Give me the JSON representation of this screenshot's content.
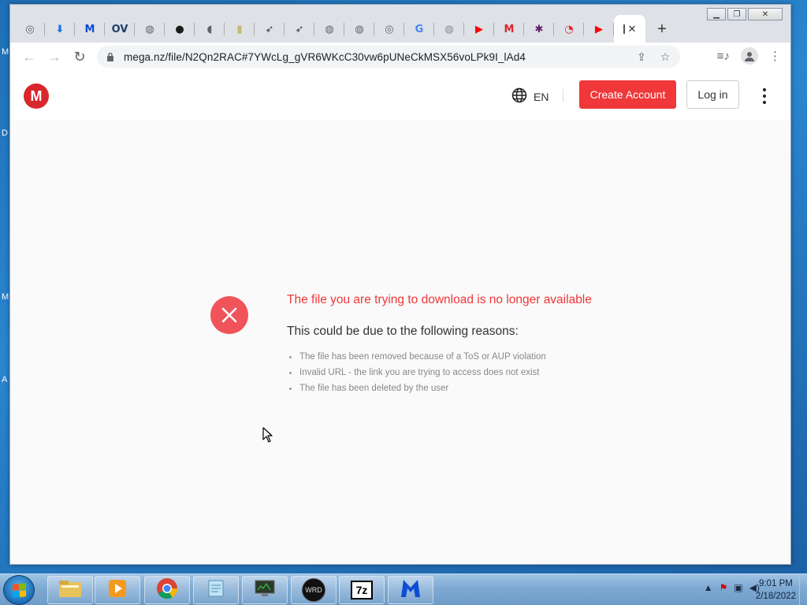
{
  "desktop": {
    "edge_chars": [
      "M",
      "D",
      "M",
      "A"
    ]
  },
  "browser": {
    "tabs": [
      {
        "icon": "chrome-icon",
        "color": "#5f6368",
        "glyph": "◎"
      },
      {
        "icon": "download-icon",
        "color": "#1a73e8",
        "glyph": "⬇"
      },
      {
        "icon": "malwarebytes-icon",
        "color": "#0d4cd3",
        "glyph": "M"
      },
      {
        "icon": "ov-icon",
        "color": "#1d3f66",
        "glyph": "OV"
      },
      {
        "icon": "globe-icon",
        "color": "#5f6368",
        "glyph": "◍"
      },
      {
        "icon": "dark-circle-icon",
        "color": "#1b1b1b",
        "glyph": "●"
      },
      {
        "icon": "audio-icon",
        "color": "#5f6368",
        "glyph": "◖"
      },
      {
        "icon": "bottle-icon",
        "color": "#c9b86b",
        "glyph": "▮"
      },
      {
        "icon": "feather-icon",
        "color": "#3a3a3a",
        "glyph": "➶"
      },
      {
        "icon": "feather-icon",
        "color": "#3a3a3a",
        "glyph": "➶"
      },
      {
        "icon": "globe-icon",
        "color": "#5f6368",
        "glyph": "◍"
      },
      {
        "icon": "globe-icon",
        "color": "#5f6368",
        "glyph": "◍"
      },
      {
        "icon": "chrome-icon",
        "color": "#5f6368",
        "glyph": "◎"
      },
      {
        "icon": "google-icon",
        "color": "#4285f4",
        "glyph": "G"
      },
      {
        "icon": "globe-icon",
        "color": "#8a8a8a",
        "glyph": "◍"
      },
      {
        "icon": "youtube-icon",
        "color": "#ff0000",
        "glyph": "▶"
      },
      {
        "icon": "mega-icon",
        "color": "#d9272e",
        "glyph": "M"
      },
      {
        "icon": "slack-icon",
        "color": "#611f69",
        "glyph": "✱"
      },
      {
        "icon": "timer-icon",
        "color": "#d9272e",
        "glyph": "◔"
      },
      {
        "icon": "youtube-icon",
        "color": "#ff0000",
        "glyph": "▶"
      }
    ],
    "active_tab_close": "✕",
    "new_tab": "+",
    "window_controls": {
      "minimize": "▁",
      "restore": "❐",
      "close": "✕"
    },
    "nav": {
      "back": "←",
      "forward": "→",
      "reload": "↻"
    },
    "url": "mega.nz/file/N2Qn2RAC#7YWcLg_gVR6WKcC30vw6pUNeCkMSX56voLPk9I_lAd4",
    "omnibox_actions": {
      "share": "⇪",
      "bookmark": "☆"
    },
    "toolbar_right": {
      "media": "≡♪",
      "menu": "⋮"
    }
  },
  "mega": {
    "logo_letter": "M",
    "language": "EN",
    "create_account": "Create Account",
    "log_in": "Log in"
  },
  "error": {
    "title": "The file you are trying to download is no longer available",
    "subtitle": "This could be due to the following reasons:",
    "reasons": [
      "The file has been removed because of a ToS or AUP violation",
      "Invalid URL - the link you are trying to access does not exist",
      "The file has been deleted by the user"
    ]
  },
  "taskbar": {
    "apps": [
      {
        "name": "explorer",
        "icon": "folder-icon"
      },
      {
        "name": "media-player",
        "icon": "media-player-icon"
      },
      {
        "name": "chrome",
        "icon": "chrome-icon"
      },
      {
        "name": "notepad",
        "icon": "notepad-icon"
      },
      {
        "name": "task-manager",
        "icon": "monitor-icon"
      },
      {
        "name": "wrd",
        "icon": "wrd-icon",
        "label": "WRD"
      },
      {
        "name": "7zip",
        "icon": "7zip-icon",
        "label": "7z"
      },
      {
        "name": "malwarebytes",
        "icon": "malwarebytes-icon"
      }
    ],
    "time": "9:01 PM",
    "date": "2/18/2022"
  }
}
